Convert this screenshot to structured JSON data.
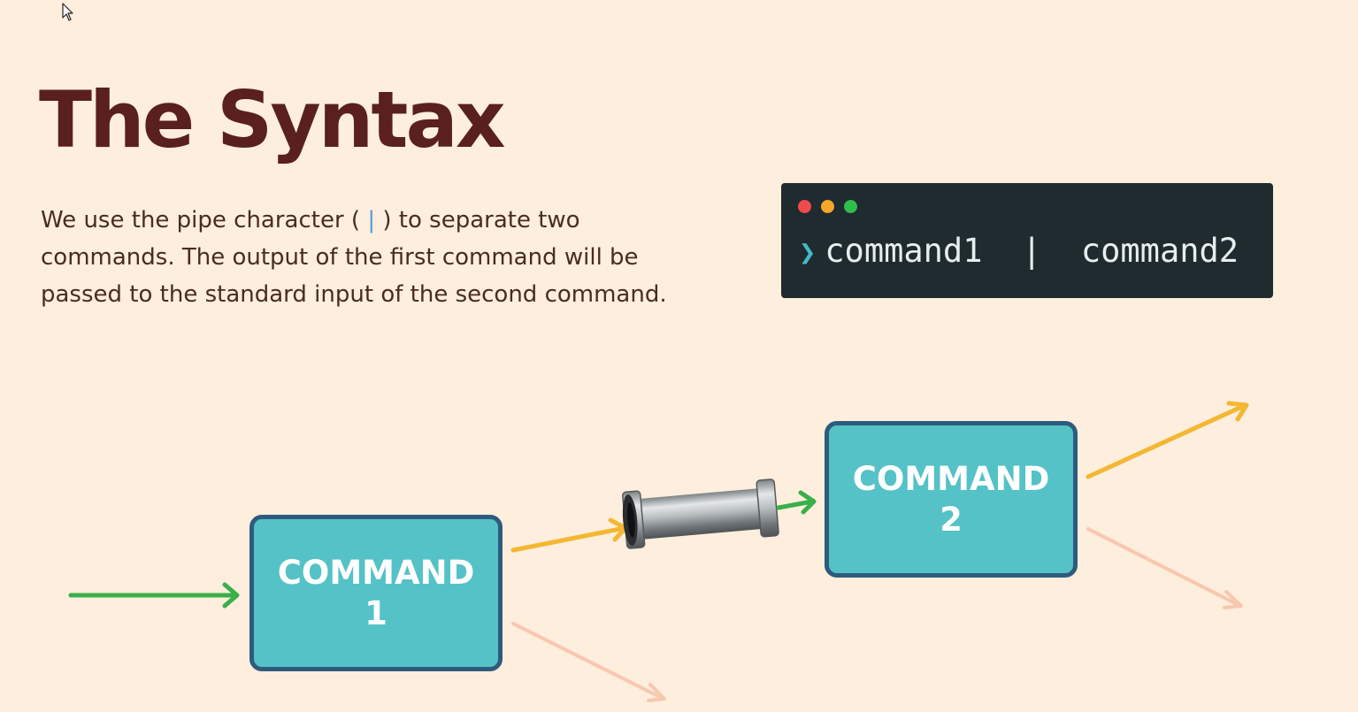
{
  "slide": {
    "title": "The Syntax",
    "description": {
      "line1_pre": "We use the pipe character ( ",
      "pipe_char": "|",
      "line1_post": " ) to separate two",
      "line2": "commands.  The output of the first command will be",
      "line3": "passed to the standard input of the second command."
    }
  },
  "terminal": {
    "prompt": "❯",
    "command": "command1  |  command2",
    "window_dots": [
      "red-dot",
      "yellow-dot",
      "green-dot"
    ]
  },
  "diagram": {
    "box1": {
      "line1": "COMMAND",
      "line2": "1"
    },
    "box2": {
      "line1": "COMMAND",
      "line2": "2"
    }
  },
  "icons": [
    "cursor-icon",
    "pipe-icon",
    "arrow-icon"
  ],
  "colors": {
    "background": "#fdeedd",
    "title_text": "#5a1f1f",
    "body_text": "#4a2b24",
    "pipe_char": "#5b9bd5",
    "terminal_bg": "#1f2b2f",
    "terminal_text": "#e8eef0",
    "prompt": "#45b8c6",
    "dot_red": "#ef4b4b",
    "dot_yellow": "#f4a72a",
    "dot_green": "#2fbd4c",
    "box_fill": "#54c2c6",
    "box_border": "#2e5b7d",
    "box_text": "#ffffff",
    "arrow_green": "#39b04a",
    "arrow_yellow": "#f3b732",
    "arrow_faint": "#f8c7b0"
  }
}
